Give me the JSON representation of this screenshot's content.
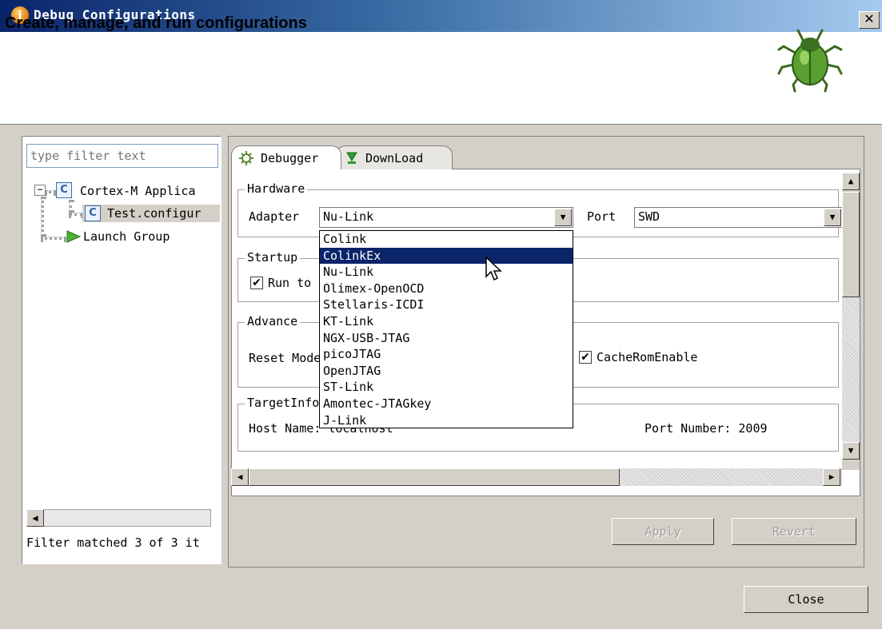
{
  "window": {
    "title": "Debug Configurations",
    "close_glyph": "✕"
  },
  "header": {
    "text": "Create, manage, and run configurations",
    "icon": "bug-icon"
  },
  "left_panel": {
    "filter_placeholder": "type filter text",
    "tree": [
      {
        "label": "Cortex-M Applica",
        "icon": "c-config-icon",
        "expander": "⊟"
      },
      {
        "label": "Test.configur",
        "icon": "c-config-icon"
      },
      {
        "label": "Launch Group",
        "icon": "launch-group-icon"
      }
    ],
    "filter_status": "Filter matched 3 of 3 it"
  },
  "tabs": [
    {
      "label": "Debugger",
      "icon": "gear-icon",
      "active": true
    },
    {
      "label": "DownLoad",
      "icon": "download-icon",
      "active": false
    }
  ],
  "hardware": {
    "group_title": "Hardware",
    "adapter_label": "Adapter",
    "adapter_value": "Nu-Link",
    "port_label": "Port",
    "port_value": "SWD"
  },
  "startup": {
    "group_title": "Startup",
    "run_label": "Run to"
  },
  "advance": {
    "group_title": "Advance",
    "reset_label": "Reset Mode",
    "cache_label": "CacheRomEnable"
  },
  "target": {
    "group_title": "TargetInfo",
    "host_label": "Host Name: localhost",
    "port_label": "Port Number: 2009"
  },
  "dropdown": {
    "selected_index": 1,
    "options": [
      "Colink",
      "ColinkEx",
      "Nu-Link",
      "Olimex-OpenOCD",
      "Stellaris-ICDI",
      "KT-Link",
      "NGX-USB-JTAG",
      "picoJTAG",
      "OpenJTAG",
      "ST-Link",
      "Amontec-JTAGkey",
      "J-Link"
    ]
  },
  "buttons": {
    "apply": "Apply",
    "revert": "Revert",
    "close": "Close"
  },
  "glyphs": {
    "down": "▼",
    "up": "▲",
    "left": "◀",
    "right": "▶",
    "check": "✔"
  }
}
